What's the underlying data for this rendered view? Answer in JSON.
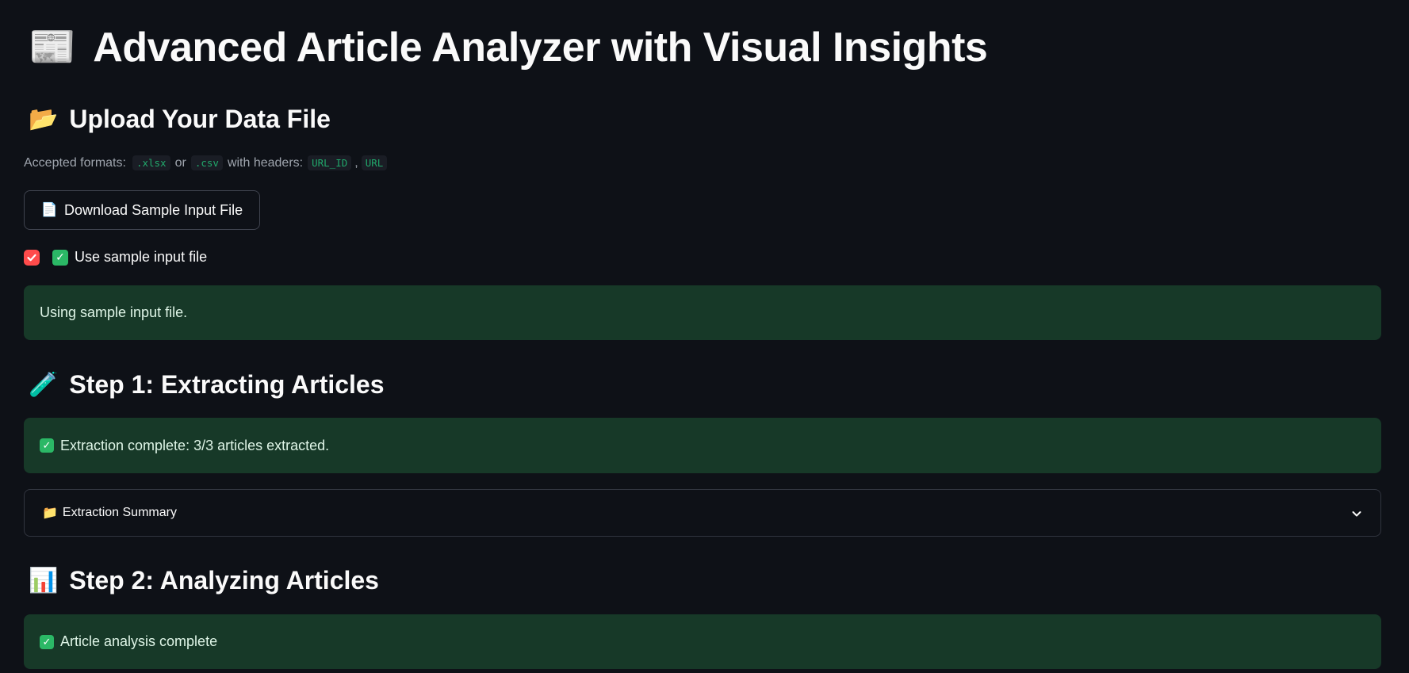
{
  "header": {
    "icon": "newspaper-icon",
    "icon_glyph": "📰",
    "title": "Advanced Article Analyzer with Visual Insights"
  },
  "upload": {
    "icon": "open-folder-icon",
    "icon_glyph": "📂",
    "heading": "Upload Your Data File",
    "caption_prefix": "Accepted formats:",
    "format_1": ".xlsx",
    "caption_or": "or",
    "format_2": ".csv",
    "caption_headers": "with headers:",
    "header_1": "URL_ID",
    "caption_comma": ",",
    "header_2": "URL",
    "download_icon": "page-icon",
    "download_icon_glyph": "📄",
    "download_label": "Download Sample Input File",
    "use_sample_checked": true,
    "use_sample_label": "Use sample input file",
    "sample_status": "Using sample input file."
  },
  "step1": {
    "icon": "test-tube-icon",
    "icon_glyph": "🧪",
    "heading": "Step 1: Extracting Articles",
    "status": "Extraction complete: 3/3 articles extracted.",
    "expander_icon": "folder-icon",
    "expander_icon_glyph": "📁",
    "expander_label": "Extraction Summary"
  },
  "step2": {
    "icon": "bar-chart-icon",
    "icon_glyph": "📊",
    "heading": "Step 2: Analyzing Articles",
    "status": "Article analysis complete"
  },
  "colors": {
    "background": "#0e1117",
    "success_bg": "#173928",
    "checkbox_accent": "#ff4b4b",
    "check_green": "#2bb866",
    "code_text": "#21a86b"
  }
}
